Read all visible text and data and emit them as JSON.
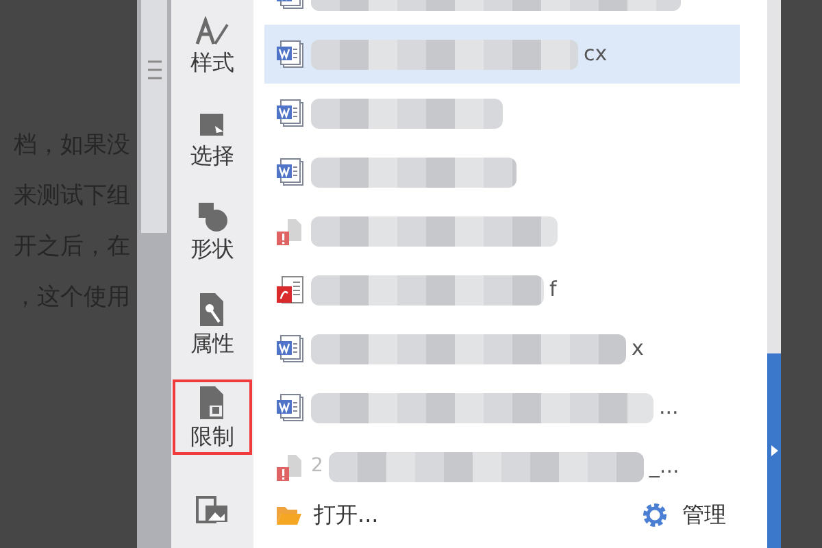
{
  "document": {
    "lines": [
      "档，如果没",
      "来测试下组",
      "开之后，在",
      "，这个使用"
    ]
  },
  "tools": [
    {
      "kind": "style",
      "label": "样式",
      "selected": false
    },
    {
      "kind": "select",
      "label": "选择",
      "selected": false
    },
    {
      "kind": "shape",
      "label": "形状",
      "selected": false
    },
    {
      "kind": "properties",
      "label": "属性",
      "selected": false
    },
    {
      "kind": "restrict",
      "label": "限制",
      "selected": true
    },
    {
      "kind": "picture",
      "selected": false
    }
  ],
  "files": [
    {
      "kind": "word",
      "selected": false
    },
    {
      "kind": "word",
      "selected": true,
      "suffix": "cx"
    },
    {
      "kind": "word",
      "selected": false
    },
    {
      "kind": "word",
      "selected": false
    },
    {
      "kind": "broken",
      "selected": false
    },
    {
      "kind": "pdf",
      "selected": false,
      "suffix": "f"
    },
    {
      "kind": "word",
      "selected": false,
      "suffix": "x"
    },
    {
      "kind": "word",
      "selected": false,
      "suffix": "..."
    },
    {
      "kind": "broken",
      "selected": false,
      "prefix": "2",
      "suffix": "_..."
    }
  ],
  "footer": {
    "open": "打开...",
    "manage": "管理"
  }
}
